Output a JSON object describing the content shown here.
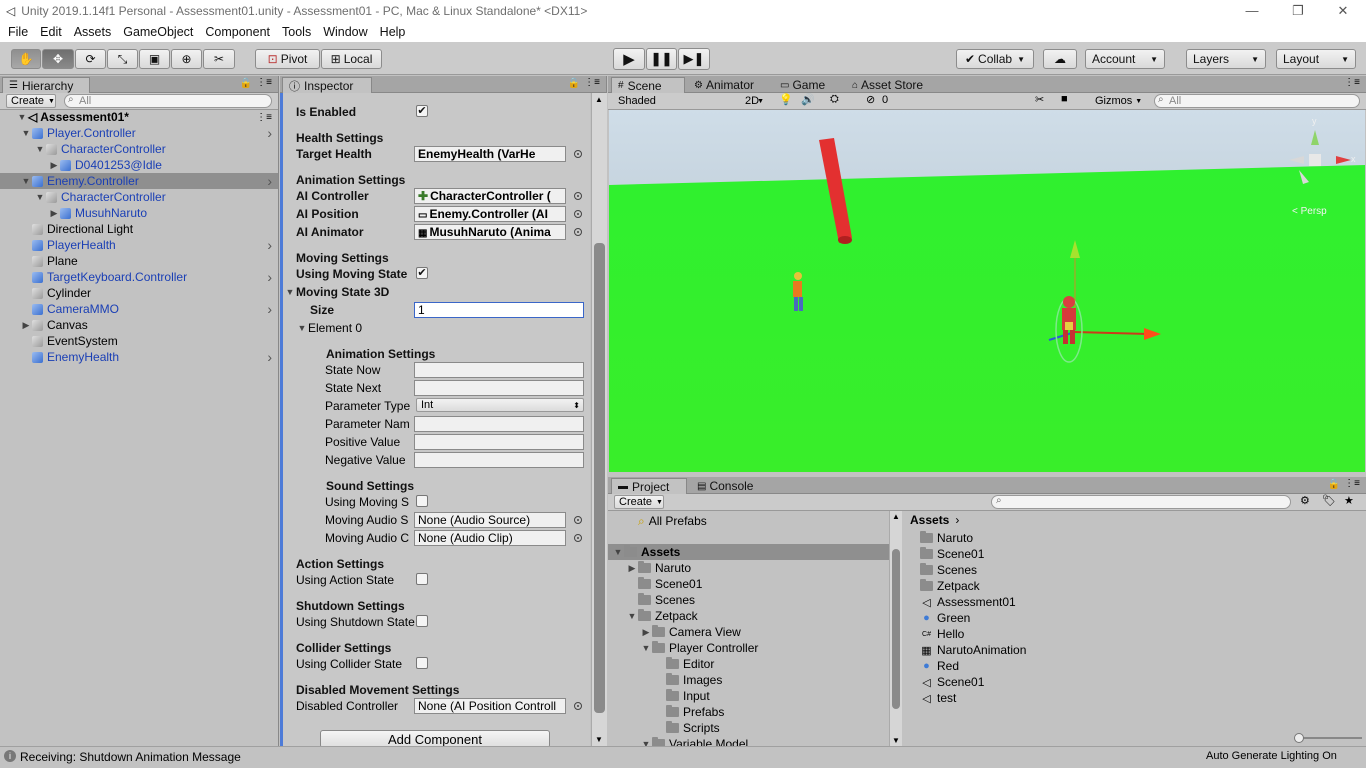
{
  "window": {
    "title": "Unity 2019.1.14f1 Personal - Assessment01.unity - Assessment01 - PC, Mac & Linux Standalone* <DX11>"
  },
  "menu": [
    "File",
    "Edit",
    "Assets",
    "GameObject",
    "Component",
    "Tools",
    "Window",
    "Help"
  ],
  "toolbar": {
    "pivot": "Pivot",
    "local": "Local",
    "collab": "Collab",
    "account": "Account",
    "layers": "Layers",
    "layout": "Layout"
  },
  "hierarchy": {
    "tab": "Hierarchy",
    "create": "Create",
    "search_placeholder": "All",
    "scene": "Assessment01*",
    "items": [
      {
        "label": "Player.Controller",
        "indent": 1,
        "blue": true,
        "expanded": true,
        "arrow": true
      },
      {
        "label": "CharacterController",
        "indent": 2,
        "blue": true,
        "expanded": true,
        "arrow": false,
        "gray": true
      },
      {
        "label": "D0401253@Idle",
        "indent": 3,
        "blue": true,
        "expanded": false,
        "arrow": false
      },
      {
        "label": "Enemy.Controller",
        "indent": 1,
        "blue": true,
        "expanded": true,
        "arrow": true,
        "selected": true
      },
      {
        "label": "CharacterController",
        "indent": 2,
        "blue": true,
        "expanded": true,
        "arrow": false,
        "gray": true
      },
      {
        "label": "MusuhNaruto",
        "indent": 3,
        "blue": true,
        "expanded": false,
        "arrow": false
      },
      {
        "label": "Directional Light",
        "indent": 1,
        "blue": false,
        "arrow": false,
        "gray": true
      },
      {
        "label": "PlayerHealth",
        "indent": 1,
        "blue": true,
        "arrow": true
      },
      {
        "label": "Plane",
        "indent": 1,
        "blue": false,
        "arrow": false,
        "gray": true
      },
      {
        "label": "TargetKeyboard.Controller",
        "indent": 1,
        "blue": true,
        "arrow": true
      },
      {
        "label": "Cylinder",
        "indent": 1,
        "blue": false,
        "arrow": false,
        "gray": true
      },
      {
        "label": "CameraMMO",
        "indent": 1,
        "blue": true,
        "arrow": true
      },
      {
        "label": "Canvas",
        "indent": 1,
        "blue": false,
        "arrow": false,
        "gray": true,
        "collapsed": true
      },
      {
        "label": "EventSystem",
        "indent": 1,
        "blue": false,
        "arrow": false,
        "gray": true
      },
      {
        "label": "EnemyHealth",
        "indent": 1,
        "blue": true,
        "arrow": true
      }
    ]
  },
  "inspector": {
    "tab": "Inspector",
    "is_enabled": "Is Enabled",
    "health_settings": "Health Settings",
    "target_health": "Target Health",
    "target_health_val": "EnemyHealth (VarHe",
    "animation_settings": "Animation Settings",
    "ai_controller": "AI Controller",
    "ai_controller_val": "CharacterController (",
    "ai_position": "AI Position",
    "ai_position_val": "Enemy.Controller (AI",
    "ai_animator": "AI Animator",
    "ai_animator_val": "MusuhNaruto (Anima",
    "moving_settings": "Moving Settings",
    "using_moving_state": "Using Moving State",
    "moving_state_3d": "Moving State 3D",
    "size": "Size",
    "size_val": "1",
    "element0": "Element 0",
    "anim_settings2": "Animation Settings",
    "state_now": "State Now",
    "state_next": "State Next",
    "param_type": "Parameter Type",
    "param_type_val": "Int",
    "param_name": "Parameter Nam",
    "positive": "Positive Value",
    "negative": "Negative Value",
    "sound_settings": "Sound Settings",
    "using_moving_s": "Using Moving S",
    "moving_audio_s": "Moving Audio S",
    "moving_audio_s_val": "None (Audio Source)",
    "moving_audio_c": "Moving Audio C",
    "moving_audio_c_val": "None (Audio Clip)",
    "action_settings": "Action Settings",
    "using_action": "Using Action State",
    "shutdown_settings": "Shutdown Settings",
    "using_shutdown": "Using Shutdown State",
    "collider_settings": "Collider Settings",
    "using_collider": "Using Collider State",
    "disabled_settings": "Disabled Movement Settings",
    "disabled_controller": "Disabled Controller",
    "disabled_controller_val": "None (AI Position Controll",
    "add_component": "Add Component"
  },
  "scene": {
    "tabs": [
      "Scene",
      "Animator",
      "Game",
      "Asset Store"
    ],
    "shaded": "Shaded",
    "mode2d": "2D",
    "gizmos": "Gizmos",
    "search_placeholder": "All",
    "hidden_count": "0",
    "persp": "< Persp"
  },
  "project": {
    "tabs": [
      "Project",
      "Console"
    ],
    "create": "Create",
    "all_prefabs": "All Prefabs",
    "tree": [
      {
        "label": "Assets",
        "indent": 0,
        "bold": true,
        "selected": true,
        "tri": "▼"
      },
      {
        "label": "Naruto",
        "indent": 1,
        "tri": "▶"
      },
      {
        "label": "Scene01",
        "indent": 1,
        "tri": ""
      },
      {
        "label": "Scenes",
        "indent": 1,
        "tri": ""
      },
      {
        "label": "Zetpack",
        "indent": 1,
        "tri": "▼"
      },
      {
        "label": "Camera View",
        "indent": 2,
        "tri": "▶"
      },
      {
        "label": "Player Controller",
        "indent": 2,
        "tri": "▼"
      },
      {
        "label": "Editor",
        "indent": 3,
        "tri": ""
      },
      {
        "label": "Images",
        "indent": 3,
        "tri": ""
      },
      {
        "label": "Input",
        "indent": 3,
        "tri": ""
      },
      {
        "label": "Prefabs",
        "indent": 3,
        "tri": ""
      },
      {
        "label": "Scripts",
        "indent": 3,
        "tri": ""
      },
      {
        "label": "Variable Model",
        "indent": 2,
        "tri": "▼"
      }
    ],
    "breadcrumb": "Assets",
    "assets": [
      {
        "label": "Naruto",
        "icon": "folder"
      },
      {
        "label": "Scene01",
        "icon": "folder"
      },
      {
        "label": "Scenes",
        "icon": "folder"
      },
      {
        "label": "Zetpack",
        "icon": "folder"
      },
      {
        "label": "Assessment01",
        "icon": "unity"
      },
      {
        "label": "Green",
        "icon": "material"
      },
      {
        "label": "Hello",
        "icon": "script"
      },
      {
        "label": "NarutoAnimation",
        "icon": "anim"
      },
      {
        "label": "Red",
        "icon": "material"
      },
      {
        "label": "Scene01",
        "icon": "unity"
      },
      {
        "label": "test",
        "icon": "unity"
      }
    ]
  },
  "status": {
    "message": "Receiving: Shutdown Animation Message",
    "right": "Auto Generate Lighting On"
  }
}
